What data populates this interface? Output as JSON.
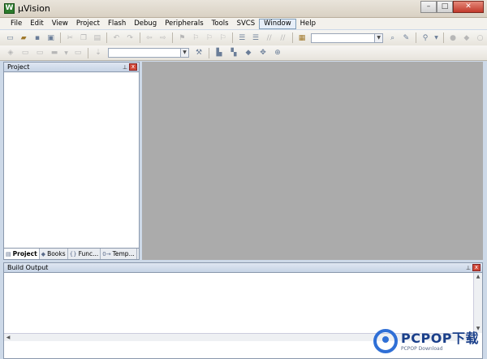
{
  "window": {
    "title": "µVision",
    "icon_letter": "W",
    "minimize": "–",
    "maximize": "□",
    "close": "✕"
  },
  "menu": {
    "items": [
      "File",
      "Edit",
      "View",
      "Project",
      "Flash",
      "Debug",
      "Peripherals",
      "Tools",
      "SVCS",
      "Window",
      "Help"
    ],
    "active": "Window"
  },
  "project_pane": {
    "title": "Project",
    "pin": "⊥",
    "close": "x",
    "tabs": [
      {
        "label": "Project",
        "icon": "▤",
        "active": true
      },
      {
        "label": "Books",
        "icon": "◆",
        "active": false
      },
      {
        "label": "Func...",
        "icon": "{}",
        "active": false
      },
      {
        "label": "Temp...",
        "icon": "0→",
        "active": false
      }
    ]
  },
  "build_output": {
    "title": "Build Output",
    "pin": "⊥",
    "close": "x"
  },
  "watermark": {
    "brand": "PCPOP下载",
    "sub": "PCPOP Download"
  },
  "toolbar": {
    "combo_target": "",
    "combo_search": ""
  }
}
